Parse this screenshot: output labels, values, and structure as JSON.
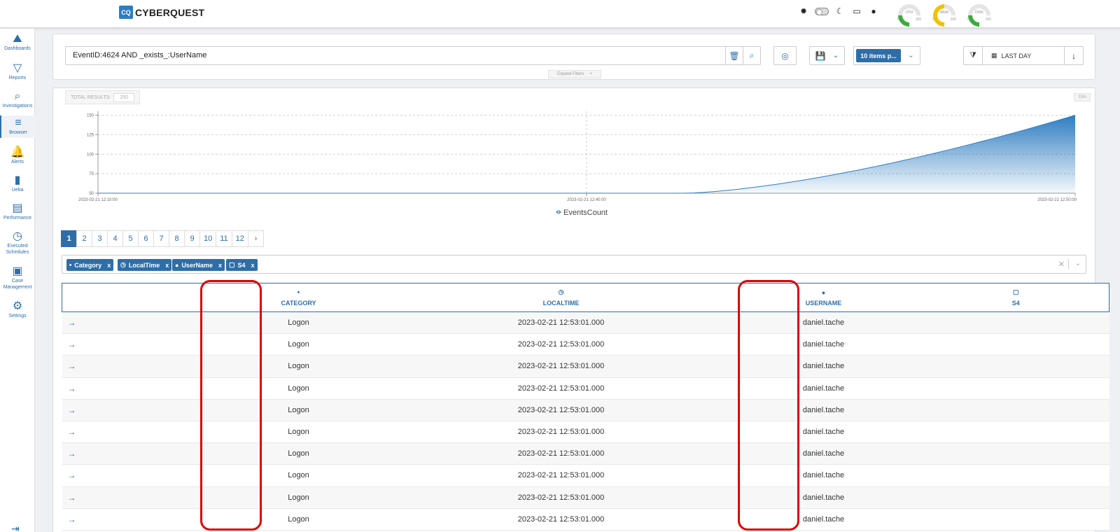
{
  "header": {
    "logo_mark": "CQ",
    "logo_text": "CYBERQUEST",
    "icons": [
      "brightness-icon",
      "theme-toggle",
      "moon-icon",
      "monitor-icon",
      "user-icon"
    ],
    "gauges": [
      {
        "label": "CPU",
        "min": "0",
        "max": "100",
        "color": "#3cab3c",
        "level": 0.1
      },
      {
        "label": "MEM",
        "min": "0",
        "max": "100",
        "color": "#f2c200",
        "level": 0.45
      },
      {
        "label": "DISK",
        "min": "0",
        "max": "100",
        "color": "#3cab3c",
        "level": 0.1
      }
    ]
  },
  "sidebar": {
    "items": [
      {
        "label": "Dashboards",
        "icon": "chart-area-icon"
      },
      {
        "label": "Reports",
        "icon": "filter-icon"
      },
      {
        "label": "Investigations",
        "icon": "search-icon"
      },
      {
        "label": "Browser",
        "icon": "list-icon",
        "active": true
      },
      {
        "label": "Alerts",
        "icon": "bell-icon"
      },
      {
        "label": "Ueba",
        "icon": "bar-chart-icon"
      },
      {
        "label": "Performance",
        "icon": "memory-icon"
      },
      {
        "label": "Executed",
        "label2": "Schedules",
        "icon": "clock-icon"
      },
      {
        "label": "Case",
        "label2": "Management",
        "icon": "briefcase-icon"
      },
      {
        "label": "Settings",
        "icon": "gear-icon"
      }
    ]
  },
  "query": {
    "value": "EventID:4624 AND _exists_:UserName",
    "items_per_page": "10 items p...",
    "date_range": "LAST DAY",
    "expand_filters": "Expand Filters",
    "expand_plus": "+"
  },
  "results": {
    "total_label": "TOTAL RESULTS:",
    "total_value": "250",
    "interval": "10m"
  },
  "chart_data": {
    "type": "area",
    "x": [
      "2023-02-21 12:10:00",
      "2023-02-21 12:40:00",
      "2023-02-21 12:50:00"
    ],
    "x_ticks": [
      "2023-02-21 12:10:00",
      "2023-02-21 12:40:00",
      "2023-02-21 12:50:00"
    ],
    "y_ticks": [
      50,
      75,
      100,
      125,
      150
    ],
    "ylim": [
      50,
      155
    ],
    "series": [
      {
        "name": "EventsCount",
        "points": [
          [
            0,
            50
          ],
          [
            0.6,
            50
          ],
          [
            1.0,
            150
          ]
        ]
      }
    ],
    "legend": "EventsCount",
    "legend_position": "bottom",
    "color": "#2e7dc1"
  },
  "pagination": {
    "pages": [
      "1",
      "2",
      "3",
      "4",
      "5",
      "6",
      "7",
      "8",
      "9",
      "10",
      "11",
      "12"
    ],
    "next": "›",
    "current": "1"
  },
  "tags": [
    "Category",
    "LocalTime",
    "UserName",
    "S4"
  ],
  "tag_remove": "x",
  "table": {
    "columns": [
      {
        "label": "",
        "icon": ""
      },
      {
        "label": "CATEGORY",
        "icon": "tags-icon"
      },
      {
        "label": "LOCALTIME",
        "icon": "clock-icon"
      },
      {
        "label": "USERNAME",
        "icon": "user-icon"
      },
      {
        "label": "S4",
        "icon": "comment-icon"
      }
    ],
    "rows": [
      {
        "category": "Logon",
        "localtime": "2023-02-21 12:53:01.000",
        "username": "daniel.tache",
        "s4": ""
      },
      {
        "category": "Logon",
        "localtime": "2023-02-21 12:53:01.000",
        "username": "daniel.tache",
        "s4": ""
      },
      {
        "category": "Logon",
        "localtime": "2023-02-21 12:53:01.000",
        "username": "daniel.tache",
        "s4": ""
      },
      {
        "category": "Logon",
        "localtime": "2023-02-21 12:53:01.000",
        "username": "daniel.tache",
        "s4": ""
      },
      {
        "category": "Logon",
        "localtime": "2023-02-21 12:53:01.000",
        "username": "daniel.tache",
        "s4": ""
      },
      {
        "category": "Logon",
        "localtime": "2023-02-21 12:53:01.000",
        "username": "daniel.tache",
        "s4": ""
      },
      {
        "category": "Logon",
        "localtime": "2023-02-21 12:53:01.000",
        "username": "daniel.tache",
        "s4": ""
      },
      {
        "category": "Logon",
        "localtime": "2023-02-21 12:53:01.000",
        "username": "daniel.tache",
        "s4": ""
      },
      {
        "category": "Logon",
        "localtime": "2023-02-21 12:53:01.000",
        "username": "daniel.tache",
        "s4": ""
      },
      {
        "category": "Logon",
        "localtime": "2023-02-21 12:53:01.000",
        "username": "daniel.tache",
        "s4": ""
      }
    ]
  },
  "colors": {
    "accent": "#2e6ea8",
    "highlight": "#e00000"
  }
}
